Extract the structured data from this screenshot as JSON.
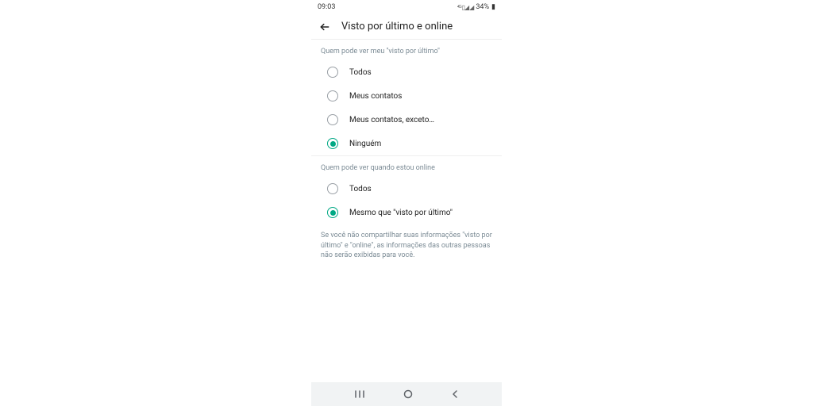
{
  "status_bar": {
    "time": "09:03",
    "battery": "34%"
  },
  "header": {
    "title": "Visto por último e online"
  },
  "section1": {
    "title": "Quem pode ver meu \"visto por último\"",
    "options": [
      {
        "label": "Todos"
      },
      {
        "label": "Meus contatos"
      },
      {
        "label": "Meus contatos, exceto…"
      },
      {
        "label": "Ninguém"
      }
    ],
    "selected_index": 3
  },
  "section2": {
    "title": "Quem pode ver quando estou online",
    "options": [
      {
        "label": "Todos"
      },
      {
        "label": "Mesmo que \"visto por último\""
      }
    ],
    "selected_index": 1
  },
  "info": "Se você não compartilhar suas informações \"visto por último\" e \"online\", as informações das outras pessoas não serão exibidas para você."
}
